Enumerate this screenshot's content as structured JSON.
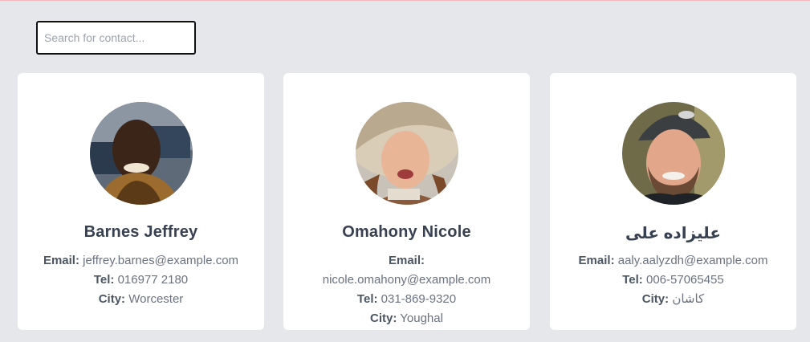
{
  "search": {
    "placeholder": "Search for contact..."
  },
  "labels": {
    "email": "Email:",
    "tel": "Tel:",
    "city": "City:"
  },
  "contacts": [
    {
      "name": "Barnes Jeffrey",
      "email": "jeffrey.barnes@example.com",
      "tel": "016977 2180",
      "city": "Worcester"
    },
    {
      "name": "Omahony Nicole",
      "email": "nicole.omahony@example.com",
      "tel": "031-869-9320",
      "city": "Youghal"
    },
    {
      "name": "علیزاده علی",
      "email": "aaly.aalyzdh@example.com",
      "tel": "006-57065455",
      "city": "کاشان"
    }
  ]
}
